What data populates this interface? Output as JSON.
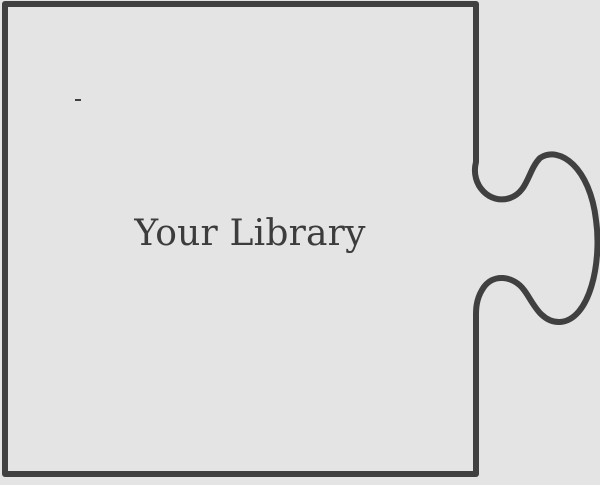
{
  "puzzle_piece": {
    "label": "Your Library",
    "colors": {
      "background": "#e4e4e4",
      "outline": "#404040",
      "text": "#3c3c3c"
    }
  }
}
